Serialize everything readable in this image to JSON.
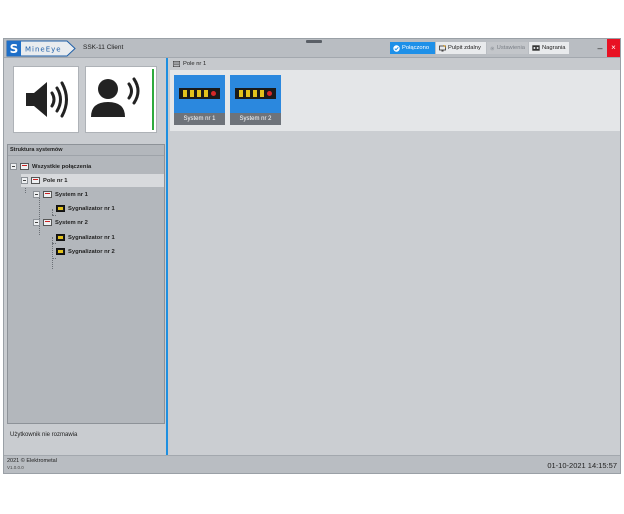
{
  "app": {
    "logo_letter": "S",
    "logo_text": "MineEye",
    "title": "SSK-11 Client"
  },
  "toolbar": {
    "connected_label": "Połączono",
    "remote_label": "Pulpit zdalny",
    "settings_label": "Ustawienia",
    "recordings_label": "Nagrania",
    "minimize_glyph": "–",
    "close_glyph": "×"
  },
  "tree": {
    "header": "Struktura systemów",
    "items": [
      {
        "label": "Wszystkie połączenia"
      },
      {
        "label": "Pole nr 1"
      },
      {
        "label": "System nr 1"
      },
      {
        "label": "Sygnalizator nr 1"
      },
      {
        "label": "System nr 2"
      },
      {
        "label": "Sygnalizator nr 1"
      },
      {
        "label": "Sygnalizator nr 2"
      }
    ]
  },
  "status": {
    "user_text": "Użytkownik nie rozmawia"
  },
  "main": {
    "breadcrumb": "Pole nr 1",
    "tiles": [
      {
        "label": "System nr 1"
      },
      {
        "label": "System nr 2"
      }
    ]
  },
  "footer": {
    "copyright": "2021 © Elektrometal",
    "version": "V1.0.0.0",
    "datetime": "01-10-2021 14:15:57"
  },
  "colors": {
    "accent": "#1e90e8",
    "close": "#e81123",
    "speaking_indicator": "#2eaa3c"
  }
}
